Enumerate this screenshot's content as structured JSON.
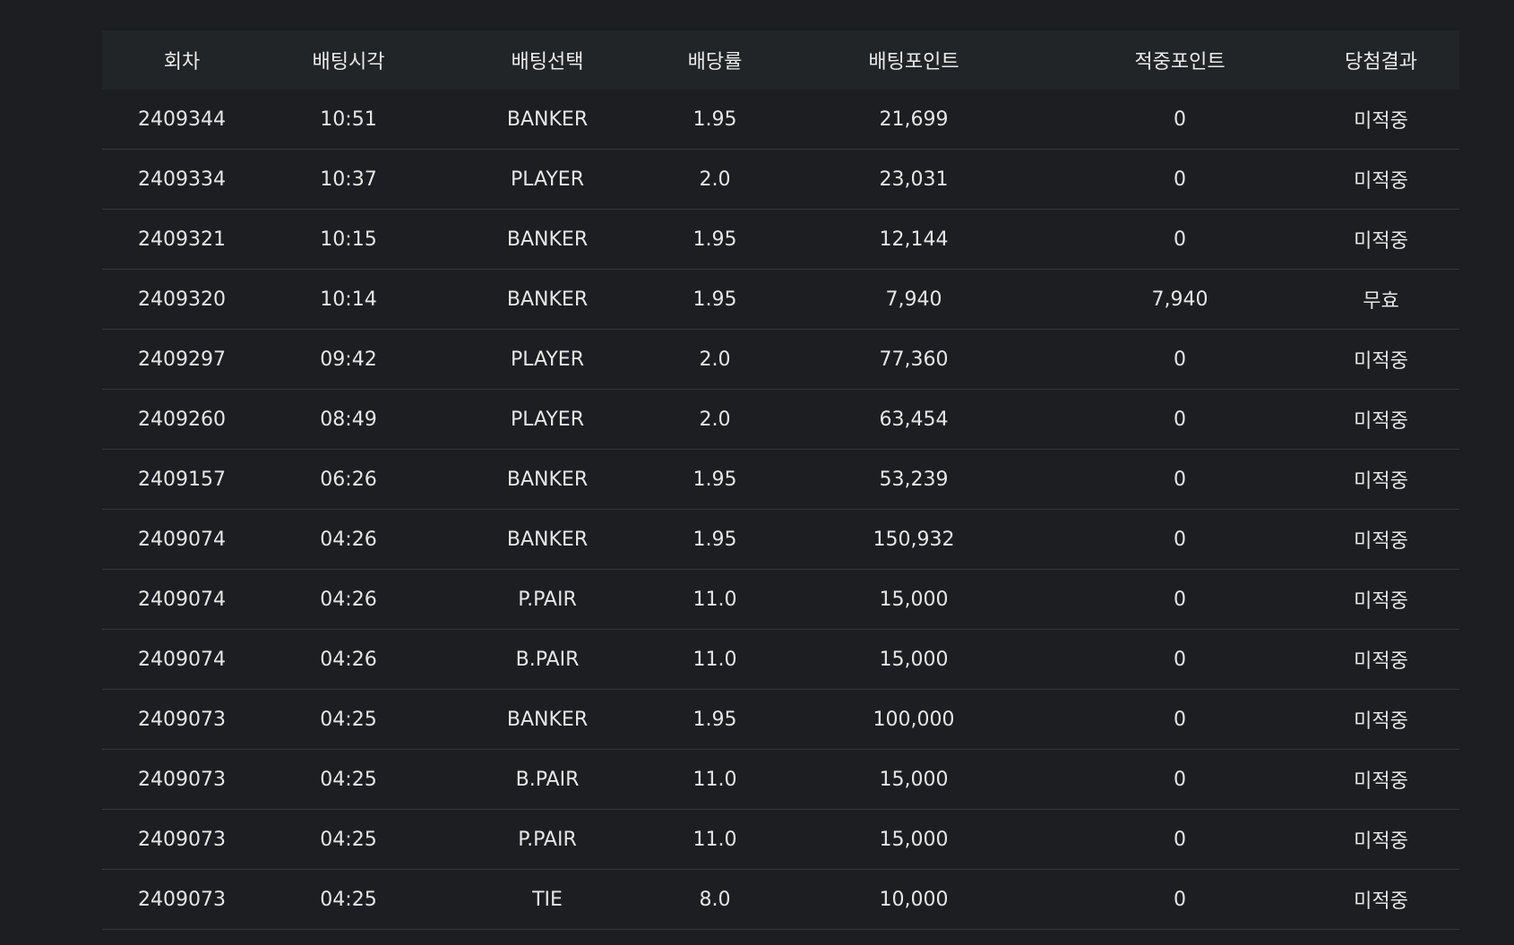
{
  "table": {
    "headers": [
      "회차",
      "배팅시각",
      "배팅선택",
      "배당률",
      "배팅포인트",
      "적중포인트",
      "당첨결과"
    ],
    "rows": [
      [
        "2409344",
        "10:51",
        "BANKER",
        "1.95",
        "21,699",
        "0",
        "미적중"
      ],
      [
        "2409334",
        "10:37",
        "PLAYER",
        "2.0",
        "23,031",
        "0",
        "미적중"
      ],
      [
        "2409321",
        "10:15",
        "BANKER",
        "1.95",
        "12,144",
        "0",
        "미적중"
      ],
      [
        "2409320",
        "10:14",
        "BANKER",
        "1.95",
        "7,940",
        "7,940",
        "무효"
      ],
      [
        "2409297",
        "09:42",
        "PLAYER",
        "2.0",
        "77,360",
        "0",
        "미적중"
      ],
      [
        "2409260",
        "08:49",
        "PLAYER",
        "2.0",
        "63,454",
        "0",
        "미적중"
      ],
      [
        "2409157",
        "06:26",
        "BANKER",
        "1.95",
        "53,239",
        "0",
        "미적중"
      ],
      [
        "2409074",
        "04:26",
        "BANKER",
        "1.95",
        "150,932",
        "0",
        "미적중"
      ],
      [
        "2409074",
        "04:26",
        "P.PAIR",
        "11.0",
        "15,000",
        "0",
        "미적중"
      ],
      [
        "2409074",
        "04:26",
        "B.PAIR",
        "11.0",
        "15,000",
        "0",
        "미적중"
      ],
      [
        "2409073",
        "04:25",
        "BANKER",
        "1.95",
        "100,000",
        "0",
        "미적중"
      ],
      [
        "2409073",
        "04:25",
        "B.PAIR",
        "11.0",
        "15,000",
        "0",
        "미적중"
      ],
      [
        "2409073",
        "04:25",
        "P.PAIR",
        "11.0",
        "15,000",
        "0",
        "미적중"
      ],
      [
        "2409073",
        "04:25",
        "TIE",
        "8.0",
        "10,000",
        "0",
        "미적중"
      ]
    ]
  },
  "colors": {
    "background": "#1c1e21",
    "header_background": "#222527",
    "row_divider": "#34373b",
    "text": "#e6e6e6"
  }
}
